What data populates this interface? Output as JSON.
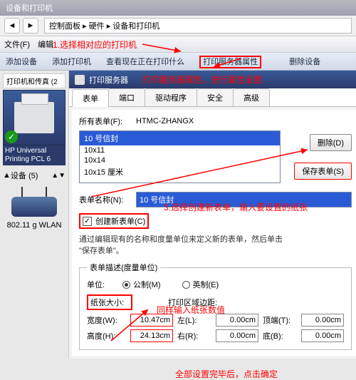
{
  "title": "设备和打印机",
  "breadcrumb": [
    "控制面板",
    "硬件",
    "设备和打印机"
  ],
  "menubar": [
    "文件(F)",
    "编辑"
  ],
  "cmdbar": [
    "添加设备",
    "添加打印机",
    "查看现在正在打印什么",
    "打印服务器属性",
    "删除设备"
  ],
  "sidebar": {
    "status": "打印机和传真 (2",
    "pcl": "HP Universal Printing PCL 6",
    "devbar": "设备 (5)",
    "wlan": "802.11 g WLAN"
  },
  "annotations": {
    "a1": "1.选择相对应的打印机",
    "a2": "打印服务器属性，进行属性设置",
    "a3": "3.选择创建新表单，输入要设置的纸张",
    "a4": "同样输入纸张数值",
    "a5": "全部设置完毕后，点击确定"
  },
  "dlg": {
    "title": "打印服务器",
    "tabs": [
      "表单",
      "端口",
      "驱动程序",
      "安全",
      "高级"
    ],
    "forms_on_label": "所有表单(F):",
    "server": "HTMC-ZHANGX",
    "forms": [
      "10 号信封",
      "10x11",
      "10x14",
      "10x15 厘米"
    ],
    "delete_btn": "删除(D)",
    "save_btn": "保存表单(S)",
    "name_label": "表单名称(N):",
    "name_value": "10 号信封",
    "create_label": "创建新表单(C)",
    "hint1": "通过编辑现有的名称和度量单位来定义新的表单，然后单击",
    "hint2": "\"保存表单\"。",
    "fs_legend": "表单描述(度量单位)",
    "unit_label": "单位:",
    "unit_metric": "公制(M)",
    "unit_english": "英制(E)",
    "size_label": "纸张大小:",
    "margin_label": "打印区域边距:",
    "w_label": "宽度(W):",
    "w": "10.47cm",
    "h_label": "高度(H):",
    "h": "24.13cm",
    "l_label": "左(L):",
    "l": "0.00cm",
    "t_label": "顶端(T):",
    "t": "0.00cm",
    "r_label": "右(R):",
    "r": "0.00cm",
    "b_label": "底(B):",
    "b": "0.00cm"
  }
}
